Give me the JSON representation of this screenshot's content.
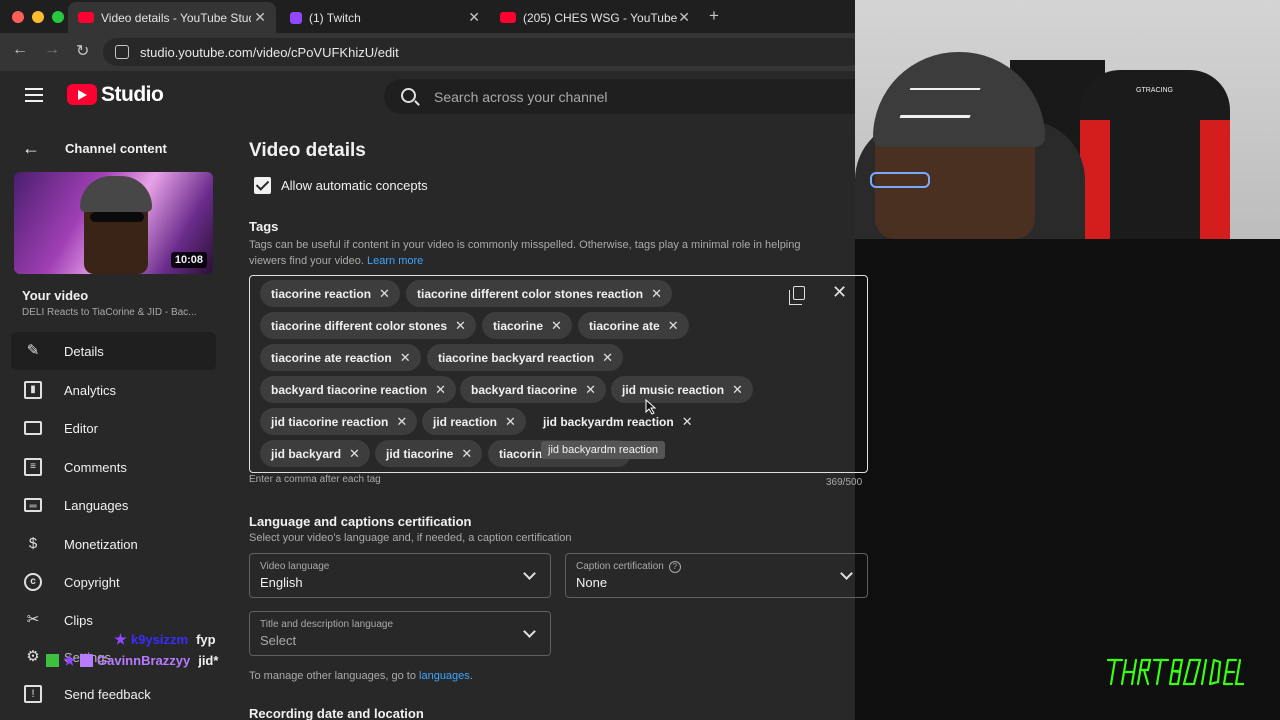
{
  "browser": {
    "tabs": [
      {
        "title": "Video details - YouTube Studio",
        "favicon": "youtube-icon",
        "active": true
      },
      {
        "title": "(1) Twitch",
        "favicon": "twitch-icon",
        "active": false
      },
      {
        "title": "(205) CHES WSG - YouTube",
        "favicon": "youtube-icon",
        "active": false
      }
    ],
    "url": "studio.youtube.com/video/cPoVUFKhizU/edit",
    "colors": {
      "chrome_bg": "#1f1f1f",
      "active_tab": "#353535"
    }
  },
  "header": {
    "logo_text": "Studio",
    "search_placeholder": "Search across your channel"
  },
  "sidebar": {
    "back_label": "Channel content",
    "thumbnail_duration": "10:08",
    "your_video_label": "Your video",
    "video_title": "DELI Reacts to TiaCorine & JID - Bac...",
    "items": [
      {
        "label": "Details",
        "icon": "pencil-icon",
        "active": true
      },
      {
        "label": "Analytics",
        "icon": "analytics-icon",
        "active": false
      },
      {
        "label": "Editor",
        "icon": "editor-icon",
        "active": false
      },
      {
        "label": "Comments",
        "icon": "comments-icon",
        "active": false
      },
      {
        "label": "Languages",
        "icon": "languages-icon",
        "active": false
      },
      {
        "label": "Monetization",
        "icon": "dollar-icon",
        "active": false
      },
      {
        "label": "Copyright",
        "icon": "copyright-icon",
        "active": false
      },
      {
        "label": "Clips",
        "icon": "scissors-icon",
        "active": false
      },
      {
        "label": "Settings",
        "icon": "gear-icon",
        "active": false
      },
      {
        "label": "Send feedback",
        "icon": "feedback-icon",
        "active": false
      }
    ]
  },
  "chat_overlay": [
    {
      "user": "k9ysizzm",
      "message": "fyp",
      "user_color": "#3b2bff"
    },
    {
      "user": "GavinnBrazzyy",
      "message": "jid*",
      "user_color": "#b77bff"
    }
  ],
  "main": {
    "title": "Video details",
    "allow_concepts_label": "Allow automatic concepts",
    "allow_concepts_checked": true,
    "tags": {
      "heading": "Tags",
      "description": "Tags can be useful if content in your video is commonly misspelled. Otherwise, tags play a minimal role in helping viewers find your video.",
      "learn_more": "Learn more",
      "chips": [
        "tiacorine reaction",
        "tiacorine different color stones reaction",
        "tiacorine different color stones",
        "tiacorine",
        "tiacorine ate",
        "tiacorine ate reaction",
        "tiacorine backyard reaction",
        "backyard tiacorine reaction",
        "backyard tiacorine",
        "jid music reaction",
        "jid tiacorine reaction",
        "jid reaction",
        "jid backyardm reaction",
        "jid backyard",
        "jid tiacorine",
        "tiacorine"
      ],
      "tooltip": "jid backyardm reaction",
      "helper": "Enter a comma after each tag",
      "counter": "369/500"
    },
    "language": {
      "heading": "Language and captions certification",
      "description": "Select your video's language and, if needed, a caption certification",
      "video_language_label": "Video language",
      "video_language_value": "English",
      "caption_label": "Caption certification",
      "caption_value": "None",
      "title_lang_label": "Title and description language",
      "title_lang_value": "Select",
      "manage_prefix": "To manage other languages, go to ",
      "manage_link": "languages",
      "manage_suffix": "."
    },
    "recording_heading": "Recording date and location"
  },
  "webcam": {
    "chair_brand": "GTRACING"
  },
  "colors": {
    "youtube_red": "#ff0033",
    "panel_bg": "#282828",
    "link": "#3ea6ff",
    "watermark_green": "#39ff14"
  }
}
